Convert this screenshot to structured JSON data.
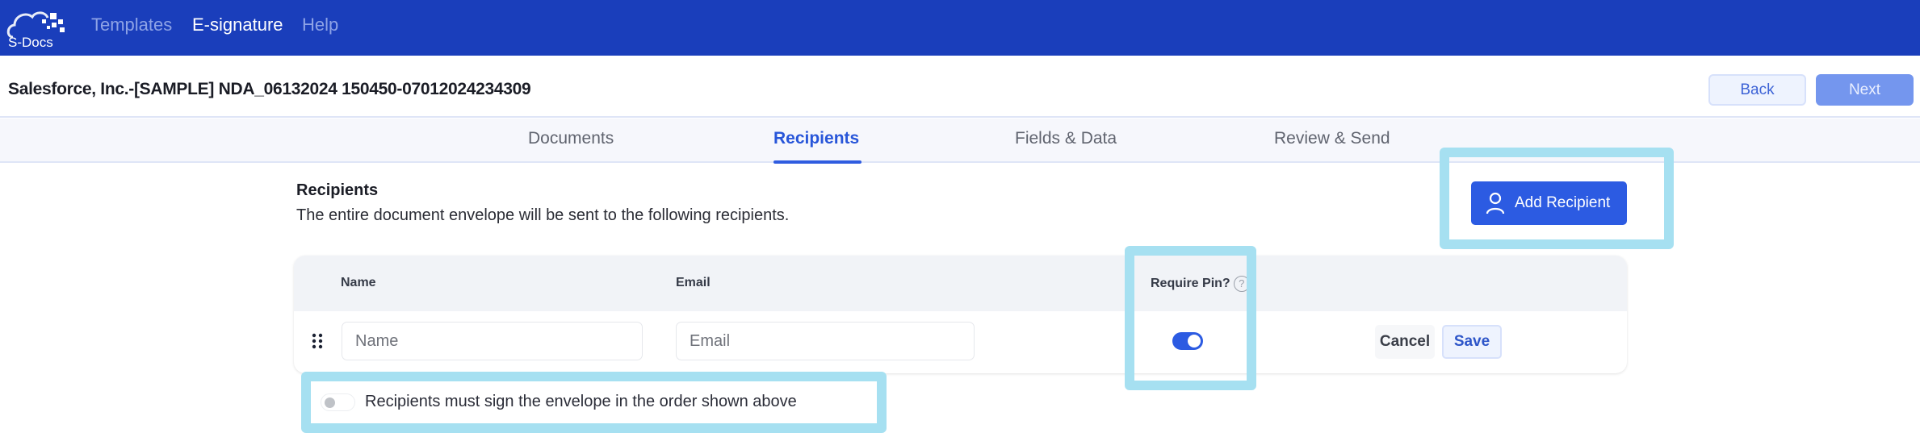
{
  "app": {
    "logo_text": "S-Docs",
    "nav": [
      {
        "label": "Templates",
        "active": false
      },
      {
        "label": "E-signature",
        "active": true
      },
      {
        "label": "Help",
        "active": false
      }
    ]
  },
  "header": {
    "document_title": "Salesforce, Inc.-[SAMPLE] NDA_06132024 150450-07012024234309",
    "back_label": "Back",
    "next_label": "Next"
  },
  "tabs": [
    {
      "label": "Documents",
      "active": false
    },
    {
      "label": "Recipients",
      "active": true
    },
    {
      "label": "Fields & Data",
      "active": false
    },
    {
      "label": "Review & Send",
      "active": false
    }
  ],
  "recipients": {
    "title": "Recipients",
    "description": "The entire document envelope will be sent to the following recipients.",
    "add_button_label": "Add Recipient",
    "columns": {
      "name": "Name",
      "email": "Email",
      "require_pin": "Require Pin?"
    },
    "help_glyph": "?",
    "row": {
      "name_placeholder": "Name",
      "email_placeholder": "Email",
      "name_value": "",
      "email_value": "",
      "require_pin": true,
      "cancel_label": "Cancel",
      "save_label": "Save"
    },
    "sign_in_order": {
      "enabled": false,
      "label": "Recipients must sign the envelope in the order shown above"
    }
  },
  "colors": {
    "brand_blue": "#1a3ebb",
    "accent": "#2c5be2",
    "highlight": "#a6e0f1"
  }
}
